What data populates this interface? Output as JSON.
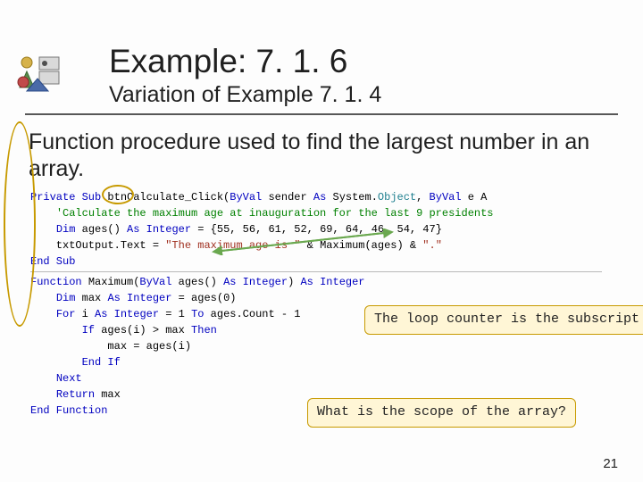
{
  "header": {
    "title": "Example: 7. 1. 6",
    "subtitle": "Variation of Example 7. 1. 4"
  },
  "body": {
    "text": "Function procedure used to find the largest number in an array."
  },
  "code": {
    "l1a": "Private Sub ",
    "l1b": "btn",
    "l1c": "Calculate_Click(",
    "l1d": "ByVal ",
    "l1e": "sender ",
    "l1f": "As ",
    "l1g": "System.",
    "l1h": "Object",
    "l1i": ", ",
    "l1j": "ByVal ",
    "l1k": "e ",
    "l1l": "A",
    "l2a": "    ",
    "l2b": "'Calculate the maximum age at inauguration for the last 9 presidents",
    "l3a": "    ",
    "l3b": "Dim ",
    "l3c": "ages() ",
    "l3d": "As Integer ",
    "l3e": "= {55, 56, 61, 52, 69, 64, 46, 54, 47}",
    "l4a": "    txtOutput.Text = ",
    "l4b": "\"The maximum age is \" ",
    "l4c": "& Maximum(ages) & ",
    "l4d": "\".\"",
    "l5a": "End Sub",
    "l6a": "Function ",
    "l6b": "Maximum(",
    "l6c": "ByVal ",
    "l6d": "ages() ",
    "l6e": "As Integer",
    "l6f": ") ",
    "l6g": "As Integer",
    "l7a": "    ",
    "l7b": "Dim ",
    "l7c": "max ",
    "l7d": "As Integer ",
    "l7e": "= ages(0)",
    "l8a": "    ",
    "l8b": "For ",
    "l8c": "i ",
    "l8d": "As Integer ",
    "l8e": "= 1 ",
    "l8f": "To ",
    "l8g": "ages.Count - 1",
    "l9a": "        ",
    "l9b": "If ",
    "l9c": "ages(i) > max ",
    "l9d": "Then",
    "l10a": "            max = ages(i)",
    "l11a": "        ",
    "l11b": "End If",
    "l12a": "    ",
    "l12b": "Next",
    "l13a": "    ",
    "l13b": "Return ",
    "l13c": "max",
    "l14a": "End Function"
  },
  "callouts": {
    "c1": "The loop counter is the subscript",
    "c2": "What is the scope of the array?"
  },
  "page": "21"
}
